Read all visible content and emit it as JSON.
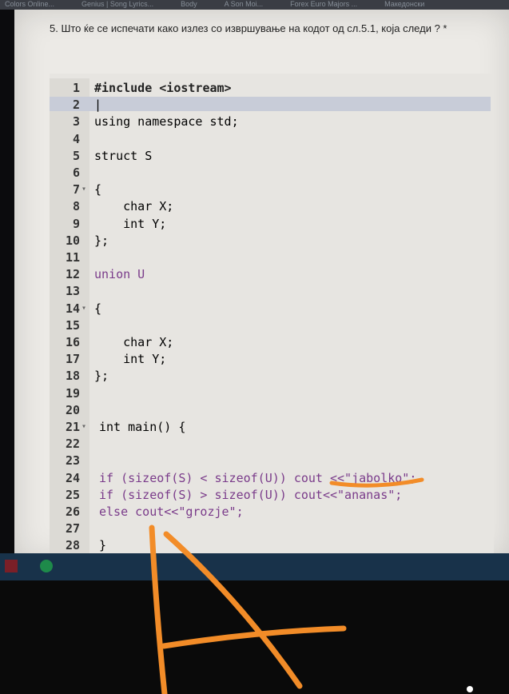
{
  "browser_tabs": [
    "Colors Online...",
    "Genius | Song Lyrics...",
    "Body",
    "A Son Moi...",
    "Forex Euro Majors ...",
    "Македонски"
  ],
  "question": "5. Што ќе се испечати како излез со извршување на кодот од сл.5.1, која следи ? *",
  "code_lines": [
    {
      "n": "1",
      "t": "#include <iostream>"
    },
    {
      "n": "2",
      "t": "|"
    },
    {
      "n": "3",
      "t": "using namespace std;"
    },
    {
      "n": "4",
      "t": ""
    },
    {
      "n": "5",
      "t": "struct S"
    },
    {
      "n": "6",
      "t": ""
    },
    {
      "n": "7",
      "t": "{"
    },
    {
      "n": "8",
      "t": "    char X;"
    },
    {
      "n": "9",
      "t": "    int Y;"
    },
    {
      "n": "10",
      "t": "};"
    },
    {
      "n": "11",
      "t": ""
    },
    {
      "n": "12",
      "t": "union U"
    },
    {
      "n": "13",
      "t": ""
    },
    {
      "n": "14",
      "t": "{"
    },
    {
      "n": "15",
      "t": ""
    },
    {
      "n": "16",
      "t": "    char X;"
    },
    {
      "n": "17",
      "t": "    int Y;"
    },
    {
      "n": "18",
      "t": "};"
    },
    {
      "n": "19",
      "t": ""
    },
    {
      "n": "20",
      "t": ""
    },
    {
      "n": "21",
      "t": "int main() {"
    },
    {
      "n": "22",
      "t": ""
    },
    {
      "n": "23",
      "t": ""
    },
    {
      "n": "24",
      "t": "if (sizeof(S) < sizeof(U)) cout <<\"jabolko\";"
    },
    {
      "n": "25",
      "t": "if (sizeof(S) > sizeof(U)) cout<<\"ananas\";"
    },
    {
      "n": "26",
      "t": "else cout<<\"grozje\";"
    },
    {
      "n": "27",
      "t": ""
    },
    {
      "n": "28",
      "t": "}"
    }
  ],
  "answer_hint": "jabolko",
  "handwritten_answer": "A",
  "colors": {
    "annotation": "#f28c28",
    "keyword": "#7a3b8a",
    "page": "#eceae6",
    "taskbar": "#18324a"
  }
}
